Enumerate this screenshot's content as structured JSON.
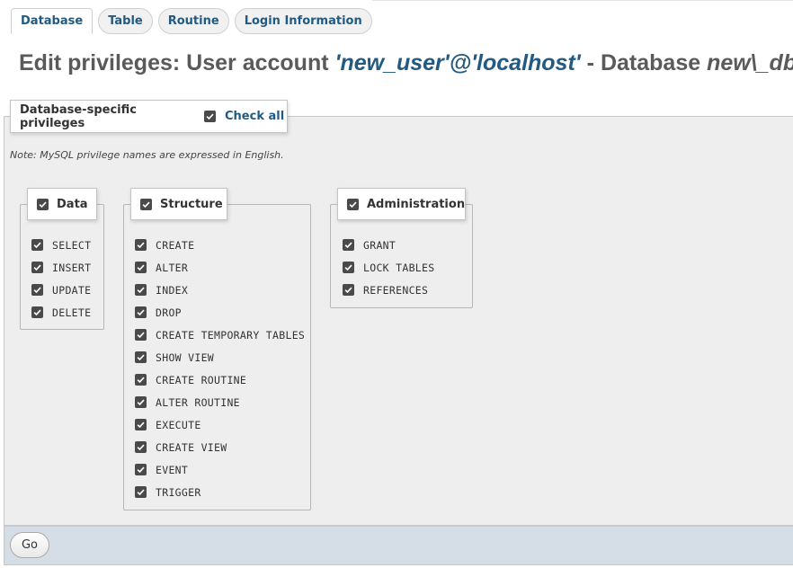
{
  "tabs": [
    {
      "label": "Database"
    },
    {
      "label": "Table"
    },
    {
      "label": "Routine"
    },
    {
      "label": "Login Information"
    }
  ],
  "title": {
    "prefix": "Edit privileges: User account ",
    "account": "'new_user'@'localhost'",
    "middle": " - Database ",
    "database": "new\\_db"
  },
  "privileges_panel": {
    "legend": "Database-specific privileges",
    "check_all_label": "Check all",
    "check_all_checked": true,
    "note": "Note: MySQL privilege names are expressed in English."
  },
  "groups": {
    "data": {
      "label": "Data",
      "checked": true,
      "items": [
        "SELECT",
        "INSERT",
        "UPDATE",
        "DELETE"
      ]
    },
    "structure": {
      "label": "Structure",
      "checked": true,
      "items": [
        "CREATE",
        "ALTER",
        "INDEX",
        "DROP",
        "CREATE TEMPORARY TABLES",
        "SHOW VIEW",
        "CREATE ROUTINE",
        "ALTER ROUTINE",
        "EXECUTE",
        "CREATE VIEW",
        "EVENT",
        "TRIGGER"
      ]
    },
    "administration": {
      "label": "Administration",
      "checked": true,
      "items": [
        "GRANT",
        "LOCK TABLES",
        "REFERENCES"
      ]
    }
  },
  "footer": {
    "go_label": "Go"
  },
  "colors": {
    "accent": "#235a81",
    "panel_bg": "#eeeeee",
    "footer_bg": "#d5dde6"
  }
}
